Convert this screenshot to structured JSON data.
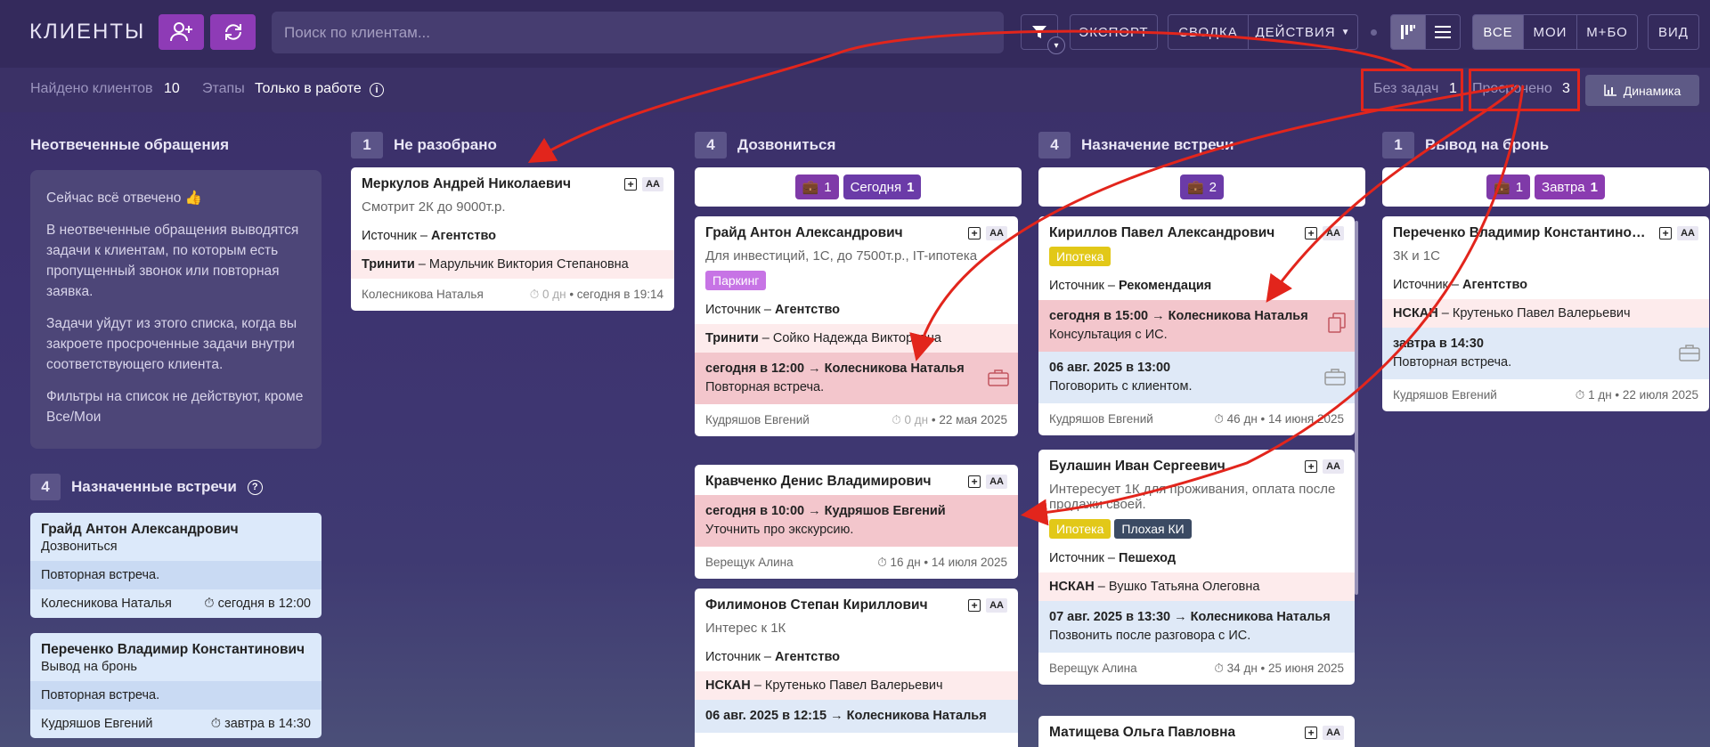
{
  "header": {
    "title": "КЛИЕНТЫ",
    "search_placeholder": "Поиск по клиентам...",
    "export": "ЭКСПОРТ",
    "summary": "СВОДКА",
    "actions": "ДЕЙСТВИЯ",
    "all": "ВСЕ",
    "mine": "МОИ",
    "mbo": "М+БО",
    "view": "ВИД"
  },
  "subbar": {
    "found_label": "Найдено клиентов",
    "found_value": "10",
    "stages_label": "Этапы",
    "stages_value": "Только в работе",
    "no_tasks_label": "Без задач",
    "no_tasks_value": "1",
    "overdue_label": "Просрочено",
    "overdue_value": "3",
    "dynamics": "Динамика"
  },
  "unanswered": {
    "title": "Неотвеченные обращения",
    "p1": "Сейчас всё отвечено 👍",
    "p2": "В неотвеченные обращения выводятся задачи к клиентам, по которым есть пропущенный звонок или повторная заявка.",
    "p3": "Задачи уйдут из этого списка, когда вы закроете просроченные задачи внутри соответствующего клиента.",
    "p4": "Фильтры на список не действуют, кроме Все/Мои"
  },
  "meetings": {
    "count": "4",
    "title": "Назначенные встречи",
    "items": [
      {
        "name": "Грайд Антон Александрович",
        "stage": "Дозвониться",
        "task": "Повторная встреча.",
        "agent": "Колесникова Наталья",
        "time": "сегодня в 12:00"
      },
      {
        "name": "Переченко Владимир Константинович",
        "stage": "Вывод на бронь",
        "task": "Повторная встреча.",
        "agent": "Кудряшов Евгений",
        "time": "завтра в 14:30"
      }
    ]
  },
  "columns": [
    {
      "count": "1",
      "title": "Не разобрано"
    },
    {
      "count": "4",
      "title": "Дозвониться",
      "chip1": "1",
      "chip2_label": "Сегодня",
      "chip2_value": "1"
    },
    {
      "count": "4",
      "title": "Назначение встречи",
      "chip1": "2"
    },
    {
      "count": "1",
      "title": "Вывод на бронь",
      "chip1": "1",
      "chip2_label": "Завтра",
      "chip2_value": "1"
    }
  ],
  "cards": {
    "merkulov": {
      "name": "Меркулов Андрей Николаевич",
      "desc": "Смотрит 2К до 9000т.р.",
      "src_label": "Источник – ",
      "src": "Агентство",
      "partner": "Тринити",
      "partner_contact": " – Марульчик Виктория Степановна",
      "agent": "Колесникова Наталья",
      "age": "0 дн",
      "date": "сегодня в 19:14"
    },
    "graid": {
      "name": "Грайд Антон Александрович",
      "desc": "Для инвестиций, 1С, до 7500т.р., IT-ипотека",
      "tag": "Паркинг",
      "src_label": "Источник – ",
      "src": "Агентство",
      "partner": "Тринити",
      "partner_contact": " – Сойко Надежда Викторовна",
      "task_head": "сегодня в 12:00 → Колесникова Наталья",
      "task_text": "Повторная встреча.",
      "agent": "Кудряшов Евгений",
      "age": "0 дн",
      "date": "22 мая 2025"
    },
    "kravchenko": {
      "name": "Кравченко Денис Владимирович",
      "task_head": "сегодня в 10:00 → Кудряшов Евгений",
      "task_text": "Уточнить про экскурсию.",
      "agent": "Верещук Алина",
      "age": "16 дн",
      "date": "14 июля 2025"
    },
    "filimonov": {
      "name": "Филимонов Степан Кириллович",
      "desc": "Интерес к 1К",
      "src_label": "Источник – ",
      "src": "Агентство",
      "partner": "НСКАН",
      "partner_contact": " – Крутенько Павел Валерьевич",
      "task_head": "06 авг. 2025 в 12:15 → Колесникова Наталья"
    },
    "kirillov": {
      "name": "Кириллов Павел Александрович",
      "tag": "Ипотека",
      "src_label": "Источник – ",
      "src": "Рекомендация",
      "task1_head": "сегодня в 15:00 → Колесникова Наталья",
      "task1_text": "Консультация с ИС.",
      "task2_head": "06 авг. 2025 в 13:00",
      "task2_text": "Поговорить с клиентом.",
      "agent": "Кудряшов Евгений",
      "age": "46 дн",
      "date": "14 июня 2025"
    },
    "bulashin": {
      "name": "Булашин Иван Сергеевич",
      "desc": "Интересует 1К для проживания, оплата после продажи своей.",
      "tag1": "Ипотека",
      "tag2": "Плохая КИ",
      "src_label": "Источник – ",
      "src": "Пешеход",
      "partner": "НСКАН",
      "partner_contact": " – Вушко Татьяна Олеговна",
      "task_head": "07 авг. 2025 в 13:30 → Колесникова Наталья",
      "task_text": "Позвонить после разговора с ИС.",
      "agent": "Верещук Алина",
      "age": "34 дн",
      "date": "25 июня 2025"
    },
    "matisheva": {
      "name": "Матищева Ольга Павловна"
    },
    "perechenko": {
      "name": "Переченко Владимир Константинович",
      "desc": "3К и 1С",
      "src_label": "Источник – ",
      "src": "Агентство",
      "partner": "НСКАН",
      "partner_contact": " – Крутенько Павел Валерьевич",
      "task_head": "завтра в 14:30",
      "task_text": "Повторная встреча.",
      "agent": "Кудряшов Евгений",
      "age": "1 дн",
      "date": "22 июля 2025"
    }
  },
  "card_badge": "AA"
}
